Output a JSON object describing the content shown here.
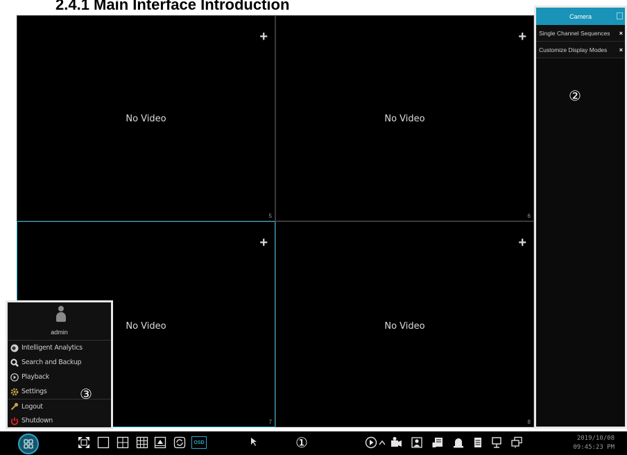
{
  "doc": {
    "heading": "2.4.1 Main Interface Introduction"
  },
  "tiles": [
    {
      "no_video": "No Video",
      "number": "5"
    },
    {
      "no_video": "No Video",
      "number": "6"
    },
    {
      "no_video": "No Video",
      "number": "7"
    },
    {
      "no_video": "No Video",
      "number": "8"
    }
  ],
  "add_symbol": "+",
  "right_panel": {
    "title": "Camera",
    "items": [
      {
        "label": "Single Channel Sequences",
        "close": "×"
      },
      {
        "label": "Customize Display Modes",
        "close": "×"
      }
    ],
    "callout": "②"
  },
  "start_menu": {
    "username": "admin",
    "items": [
      {
        "label": "Intelligent Analytics",
        "icon": "analytics-icon"
      },
      {
        "label": "Search and Backup",
        "icon": "search-icon"
      },
      {
        "label": "Playback",
        "icon": "play-icon"
      },
      {
        "label": "Settings",
        "icon": "gear-icon"
      },
      {
        "label": "Logout",
        "icon": "key-icon"
      },
      {
        "label": "Shutdown",
        "icon": "power-icon"
      }
    ],
    "callout": "③"
  },
  "taskbar": {
    "osd_label": "OSD",
    "callout": "①",
    "date": "2019/10/08",
    "time": "09:45:23 PM"
  },
  "colors": {
    "accent": "#2aa7c9",
    "panel_header": "#1a93b8",
    "shutdown": "#e02020"
  }
}
